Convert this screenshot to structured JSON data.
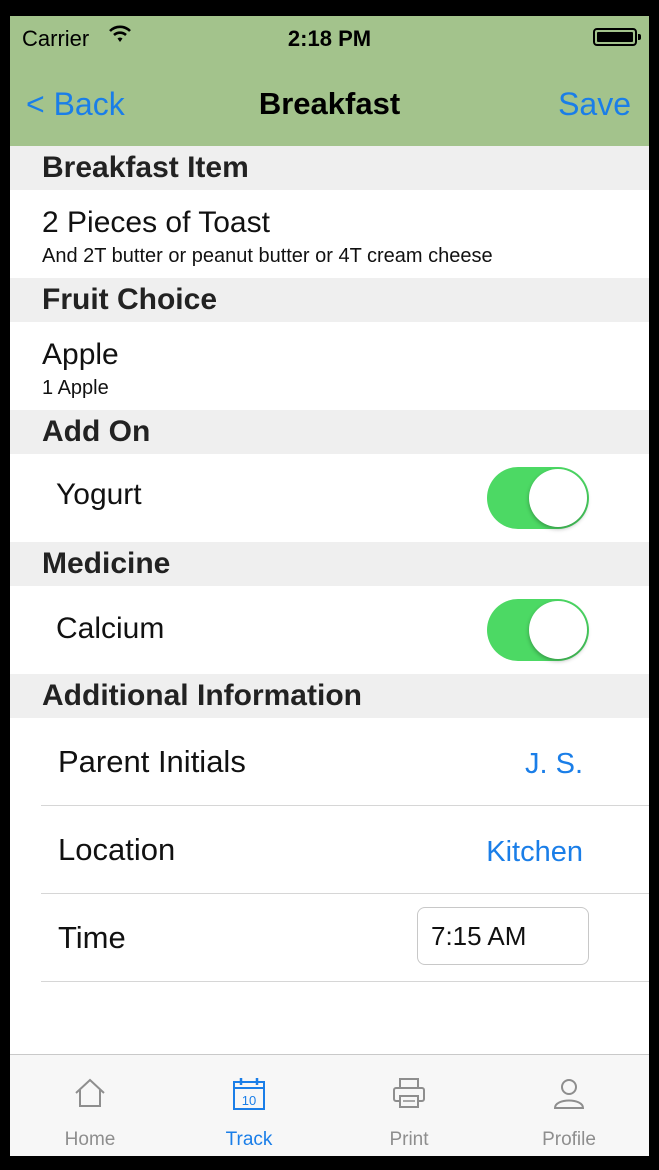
{
  "status_bar": {
    "carrier": "Carrier",
    "time": "2:18 PM"
  },
  "nav": {
    "back_label": "< Back",
    "title": "Breakfast",
    "save_label": "Save"
  },
  "sections": {
    "breakfast_item": {
      "header": "Breakfast Item",
      "title": "2 Pieces of Toast",
      "subtitle": "And 2T butter or peanut butter or 4T cream cheese"
    },
    "fruit_choice": {
      "header": "Fruit Choice",
      "title": "Apple",
      "subtitle": "1 Apple"
    },
    "add_on": {
      "header": "Add On",
      "label": "Yogurt",
      "on": true
    },
    "medicine": {
      "header": "Medicine",
      "label": "Calcium",
      "on": true
    },
    "additional": {
      "header": "Additional Information",
      "rows": [
        {
          "label": "Parent Initials",
          "value": "J. S."
        },
        {
          "label": "Location",
          "value": "Kitchen"
        },
        {
          "label": "Time",
          "value": "7:15 AM"
        }
      ]
    }
  },
  "tabbar": {
    "tabs": [
      {
        "label": "Home",
        "icon": "home-icon",
        "active": false
      },
      {
        "label": "Track",
        "icon": "calendar-icon",
        "calendar_day": "10",
        "active": true
      },
      {
        "label": "Print",
        "icon": "printer-icon",
        "active": false
      },
      {
        "label": "Profile",
        "icon": "person-icon",
        "active": false
      }
    ]
  },
  "colors": {
    "navbar_bg": "#a3c38c",
    "tint": "#1a7ee8",
    "toggle_on": "#4cd964",
    "section_bg": "#efefef"
  }
}
